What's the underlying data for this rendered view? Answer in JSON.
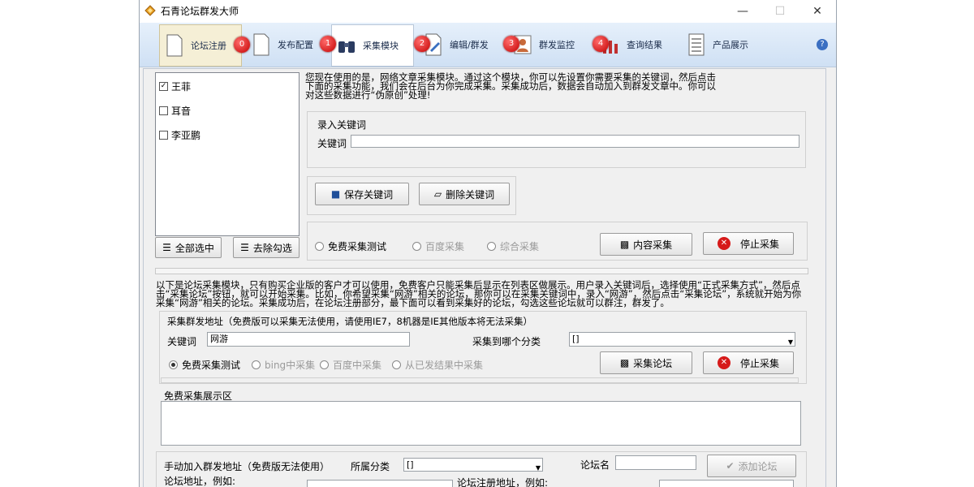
{
  "window": {
    "title": "石青论坛群发大师"
  },
  "tabs": [
    {
      "label": "论坛注册",
      "badge": "0"
    },
    {
      "label": "发布配置",
      "badge": "1"
    },
    {
      "label": "采集模块",
      "badge": "2"
    },
    {
      "label": "编辑/群发",
      "badge": "3"
    },
    {
      "label": "群发监控",
      "badge": "4"
    },
    {
      "label": "查询结果",
      "badge": ""
    },
    {
      "label": "产品展示",
      "badge": ""
    }
  ],
  "help": "?",
  "keywords_list": [
    {
      "label": "王菲",
      "checked": true
    },
    {
      "label": "耳音",
      "checked": false
    },
    {
      "label": "李亚鹏",
      "checked": false
    }
  ],
  "left_buttons": {
    "select_all": "全部选中",
    "deselect": "去除勾选"
  },
  "article": {
    "intro": "您现在使用的是，网络文章采集模块。通过这个模块，你可以先设置你需要采集的关键词，然后点击下面的采集功能，我们会在后台为你完成采集。采集成功后，数据会自动加入到群发文章中。你可以对这些数据进行“伪原创”处理!",
    "group_label": "录入关键词",
    "keyword_label": "关键词",
    "keyword_value": "",
    "save_button": "保存关键词",
    "delete_button": "删除关键词",
    "radios": [
      "免费采集测试",
      "百度采集",
      "综合采集"
    ],
    "collect_button": "内容采集",
    "stop_button": "停止采集"
  },
  "forum": {
    "intro": "以下是论坛采集模块，只有购买企业版的客户才可以使用，免费客户只能采集后显示在列表区做展示。用户录入关键词后，选择使用“正式采集方式”，然后点击“采集论坛”按钮，就可以开始采集。比如，你希望采集“网游”相关的论坛，那你可以在采集关键词中，录入“网游”，然后点击“采集论坛”，系统就开始为你采集“网游”相关的论坛。采集成功后，在论坛注册部分，最下面可以看到采集好的论坛，勾选这些论坛就可以群注，群发了。",
    "group_label": "采集群发地址（免费版可以采集无法使用，请使用IE7，8机器是IE其他版本将无法采集）",
    "keyword_label": "关键词",
    "keyword_value": "网游",
    "category_label": "采集到哪个分类",
    "category_value": "[]",
    "radios": [
      "免费采集测试",
      "bing中采集",
      "百度中采集",
      "从已发结果中采集"
    ],
    "collect_button": "采集论坛",
    "stop_button": "停止采集",
    "display_label": "免费采集展示区"
  },
  "manual": {
    "label": "手动加入群发地址（免费版无法使用）",
    "category_label": "所属分类",
    "category_value": "[]",
    "forum_name_label": "论坛名",
    "add_button": "添加论坛",
    "forum_addr_label": "论坛地址，例如:",
    "forum_reg_label": "论坛注册地址，例如:"
  },
  "colors": {
    "toolbar": "#d8e6f6",
    "badge": "#d40000",
    "window_bg": "#f0f0f0"
  }
}
